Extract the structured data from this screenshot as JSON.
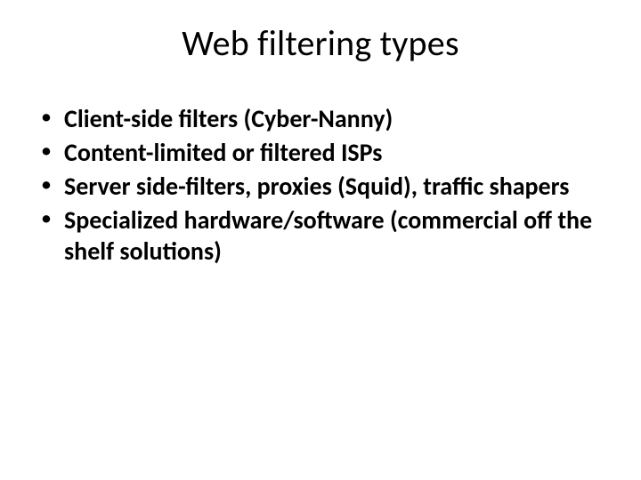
{
  "slide": {
    "title": "Web filtering types",
    "bullets": [
      "Client-side filters (Cyber-Nanny)",
      "Content-limited or filtered ISPs",
      "Server side-filters, proxies (Squid), traffic shapers",
      "Specialized hardware/software (commercial off the shelf solutions)"
    ]
  }
}
